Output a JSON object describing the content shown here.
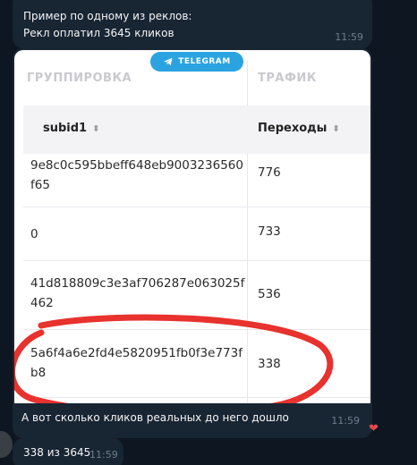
{
  "messages": {
    "first": {
      "line1": "Пример по одному из реклов:",
      "line2": "Рекл оплатил 3645 кликов",
      "time": "11:59"
    },
    "image_message": {
      "badge": "TELEGRAM",
      "caption": "А вот сколько кликов реальных до него дошло",
      "time": "11:59",
      "reaction_icon": "heart-icon",
      "screenshot": {
        "group_header": "ГРУППИРОВКА",
        "traffic_header": "ТРАФИК",
        "col_subid": "subid1",
        "col_clicks": "Переходы",
        "sort_icon": "sort-icon",
        "rows": [
          {
            "subid": "9e8c0c595bbeff648eb9003236560f65",
            "clicks": "776"
          },
          {
            "subid": "0",
            "clicks": "733"
          },
          {
            "subid": "41d818809c3e3af706287e063025f462",
            "clicks": "536"
          },
          {
            "subid": "5a6f4a6e2fd4e5820951fb0f3e773fb8",
            "clicks": "338"
          }
        ],
        "highlight_color": "#e8322d"
      }
    },
    "last": {
      "text": "338 из 3645",
      "time": "11:59"
    }
  },
  "colors": {
    "background": "#0e1621",
    "bubble": "#182533",
    "badge": "#2aa3e0",
    "timestamp": "#6d7f8f"
  }
}
